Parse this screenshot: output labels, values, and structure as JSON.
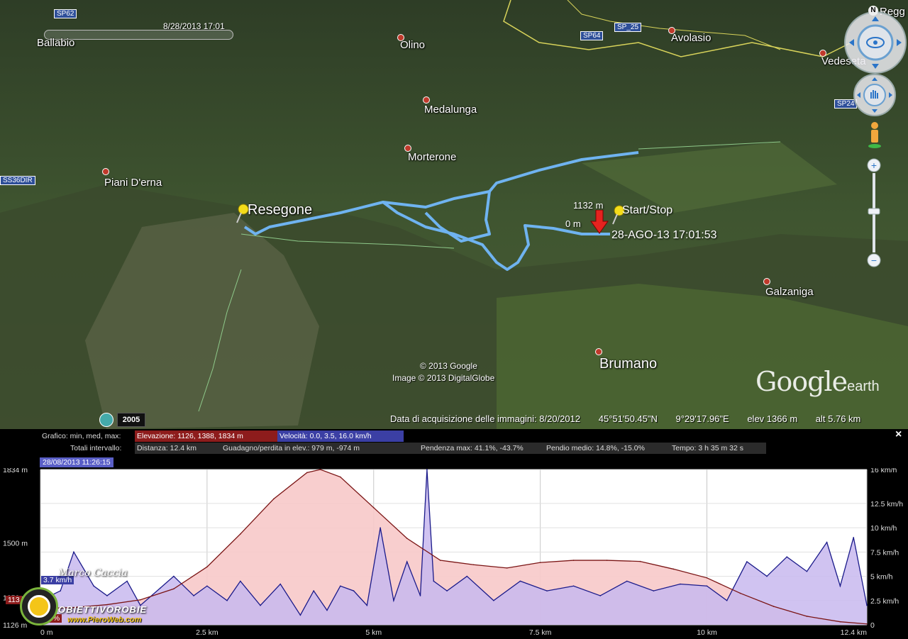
{
  "map": {
    "timestamp": "8/28/2013  17:01",
    "places": [
      {
        "id": "ballabio",
        "label": "Ballabio",
        "size": "small",
        "dot": false
      },
      {
        "id": "olino",
        "label": "Olino",
        "size": "small",
        "dot": true
      },
      {
        "id": "avolasio",
        "label": "Avolasio",
        "size": "small",
        "dot": true
      },
      {
        "id": "vedeseta",
        "label": "Vedeseta",
        "size": "small",
        "dot": true
      },
      {
        "id": "medalunga",
        "label": "Medalunga",
        "size": "small",
        "dot": true
      },
      {
        "id": "morterone",
        "label": "Morterone",
        "size": "small",
        "dot": true
      },
      {
        "id": "piani",
        "label": "Piani D'erna",
        "size": "small",
        "dot": true
      },
      {
        "id": "resegone",
        "label": "Resegone",
        "size": "big",
        "dot": false
      },
      {
        "id": "galzaniga",
        "label": "Galzaniga",
        "size": "small",
        "dot": true
      },
      {
        "id": "brumano",
        "label": "Brumano",
        "size": "big",
        "dot": true
      },
      {
        "id": "regg",
        "label": "Regg",
        "size": "small",
        "dot": false
      }
    ],
    "roads": [
      "SP62",
      "SP64",
      "SP_25",
      "SP24",
      "SS36DIR"
    ],
    "start_stop_label": "Start/Stop",
    "elev_marker_top": "1132 m",
    "elev_marker_bottom": "0 m",
    "marker_datetime": "28-AGO-13 17:01:53",
    "copyright1": "© 2013 Google",
    "copyright2": "Image © 2013 DigitalGlobe",
    "year_badge": "2005",
    "logo_main": "Google",
    "logo_sub": "earth",
    "status": {
      "acquisition": "Data di acquisizione delle immagini: 8/20/2012",
      "lat": "45°51'50.45\"N",
      "lon": "9°29'17.96\"E",
      "elev": "elev  1366 m",
      "alt": "alt  5.76 km"
    },
    "colors": {
      "track": "#6fb3f0",
      "place_dot": "#c0392b"
    }
  },
  "panel": {
    "row1_label": "Grafico: min, med, max:",
    "row1_elev": "Elevazione: 1126, 1388, 1834 m",
    "row1_speed": "Velocità: 0.0, 3.5, 16.0 km/h",
    "row2_label": "Totali intervallo:",
    "row2_dist": "Distanza: 12.4 km",
    "row2_gain": "Guadagno/perdita in elev.: 979 m, -974 m",
    "row2_slope_max": "Pendenza max: 41.1%, -43.7%",
    "row2_slope_avg": "Pendio medio: 14.8%, -15.0%",
    "row2_time": "Tempo: 3 h 35 m 32 s",
    "date_box": "28/08/2013 11:26:15",
    "close": "×",
    "cursor_speed": "3.7 km/h",
    "cursor_elev": "113",
    "cursor_slope": "3%",
    "watermark_author": "Marco Caccia",
    "watermark_brand": "OBIETTIVOROBIE",
    "watermark_url": "www.PieroWeb.com"
  },
  "chart_data": {
    "type": "area",
    "x_unit": "km",
    "x_ticks": [
      "0 m",
      "2.5 km",
      "5 km",
      "7.5 km",
      "10 km",
      "12.4 km"
    ],
    "x_tick_values": [
      0,
      2.5,
      5,
      7.5,
      10,
      12.4
    ],
    "xlim": [
      0,
      12.4
    ],
    "y_left_ticks": [
      "1834 m",
      "1500 m",
      "1250 m",
      "1126 m"
    ],
    "y_left_values": [
      1834,
      1500,
      1250,
      1126
    ],
    "ylim_left": [
      1126,
      1834
    ],
    "y_right_ticks": [
      "16 km/h",
      "12.5 km/h",
      "10 km/h",
      "7.5 km/h",
      "5 km/h",
      "2.5 km/h",
      "0"
    ],
    "y_right_values": [
      16,
      12.5,
      10,
      7.5,
      5,
      2.5,
      0
    ],
    "ylim_right": [
      0,
      16
    ],
    "grid": true,
    "series": [
      {
        "name": "Elevazione",
        "color": "#7a1414",
        "fill": "#f7c9c9",
        "x": [
          0,
          0.5,
          1.0,
          1.5,
          2.0,
          2.5,
          3.0,
          3.5,
          4.0,
          4.2,
          4.5,
          5.0,
          5.5,
          6.0,
          6.5,
          7.0,
          7.5,
          8.0,
          8.5,
          9.0,
          9.5,
          10.0,
          10.5,
          11.0,
          11.5,
          12.0,
          12.4
        ],
        "y": [
          1200,
          1205,
          1218,
          1240,
          1290,
          1390,
          1540,
          1700,
          1820,
          1834,
          1800,
          1660,
          1520,
          1420,
          1400,
          1385,
          1410,
          1420,
          1420,
          1415,
          1380,
          1340,
          1270,
          1210,
          1165,
          1140,
          1130
        ]
      },
      {
        "name": "Velocità",
        "color": "#1a1a8a",
        "fill": "#c8b8ee",
        "x": [
          0,
          0.3,
          0.5,
          0.8,
          1.0,
          1.3,
          1.5,
          1.8,
          2.0,
          2.3,
          2.5,
          2.8,
          3.0,
          3.3,
          3.6,
          3.9,
          4.1,
          4.3,
          4.5,
          4.7,
          4.9,
          5.1,
          5.3,
          5.5,
          5.7,
          5.8,
          5.9,
          6.1,
          6.4,
          6.8,
          7.2,
          7.6,
          8.0,
          8.4,
          8.8,
          9.2,
          9.6,
          10.0,
          10.3,
          10.6,
          10.9,
          11.2,
          11.5,
          11.8,
          12.0,
          12.2,
          12.4
        ],
        "y": [
          2.5,
          3.5,
          7.5,
          4.0,
          3.0,
          4.5,
          2.0,
          3.8,
          5.0,
          3.0,
          4.0,
          2.5,
          4.5,
          2.0,
          4.2,
          1.0,
          3.5,
          1.5,
          4.0,
          3.5,
          2.0,
          10.0,
          2.5,
          6.5,
          3.0,
          16.0,
          4.5,
          3.5,
          5.0,
          2.5,
          4.5,
          3.5,
          4.0,
          3.0,
          4.5,
          3.5,
          4.2,
          4.0,
          2.5,
          6.5,
          5.0,
          7.0,
          5.5,
          8.5,
          4.0,
          9.0,
          2.0
        ]
      }
    ]
  }
}
